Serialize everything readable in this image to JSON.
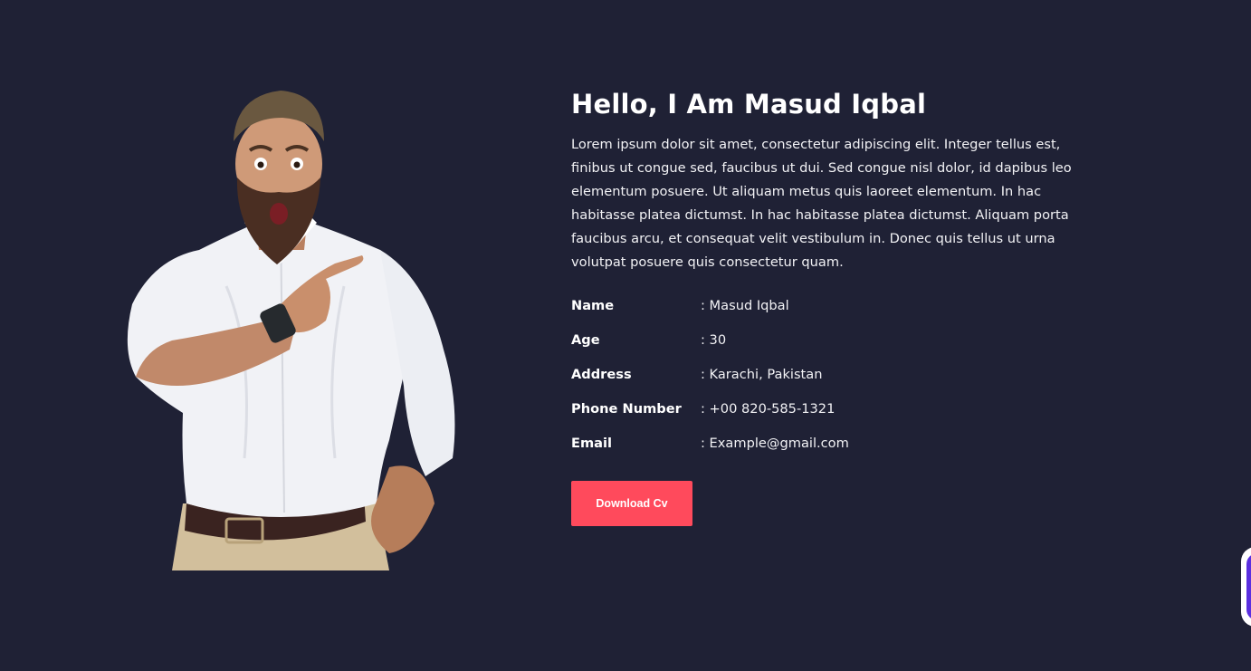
{
  "about": {
    "heading": "Hello, I Am Masud Iqbal",
    "bio": "Lorem ipsum dolor sit amet, consectetur adipiscing elit. Integer tellus est, finibus ut congue sed, faucibus ut dui. Sed congue nisl dolor, id dapibus leo elementum posuere. Ut aliquam metus quis laoreet elementum. In hac habitasse platea dictumst. In hac habitasse platea dictumst. Aliquam porta faucibus arcu, et consequat velit vestibulum in. Donec quis tellus ut urna volutpat posuere quis consectetur quam.",
    "info": [
      {
        "label": "Name",
        "value": ": Masud Iqbal"
      },
      {
        "label": "Age",
        "value": ": 30"
      },
      {
        "label": "Address",
        "value": ": Karachi, Pakistan"
      },
      {
        "label": "Phone Number",
        "value": ": +00 820-585-1321"
      },
      {
        "label": "Email",
        "value": ": Example@gmail.com"
      }
    ],
    "download_label": "Download Cv"
  },
  "colors": {
    "background": "#1f2135",
    "accent": "#ff4a5c",
    "widget": "#5a2fe0"
  },
  "icons": {
    "portrait": "man-pointing-photo",
    "edge_widget": "floating-widget"
  }
}
